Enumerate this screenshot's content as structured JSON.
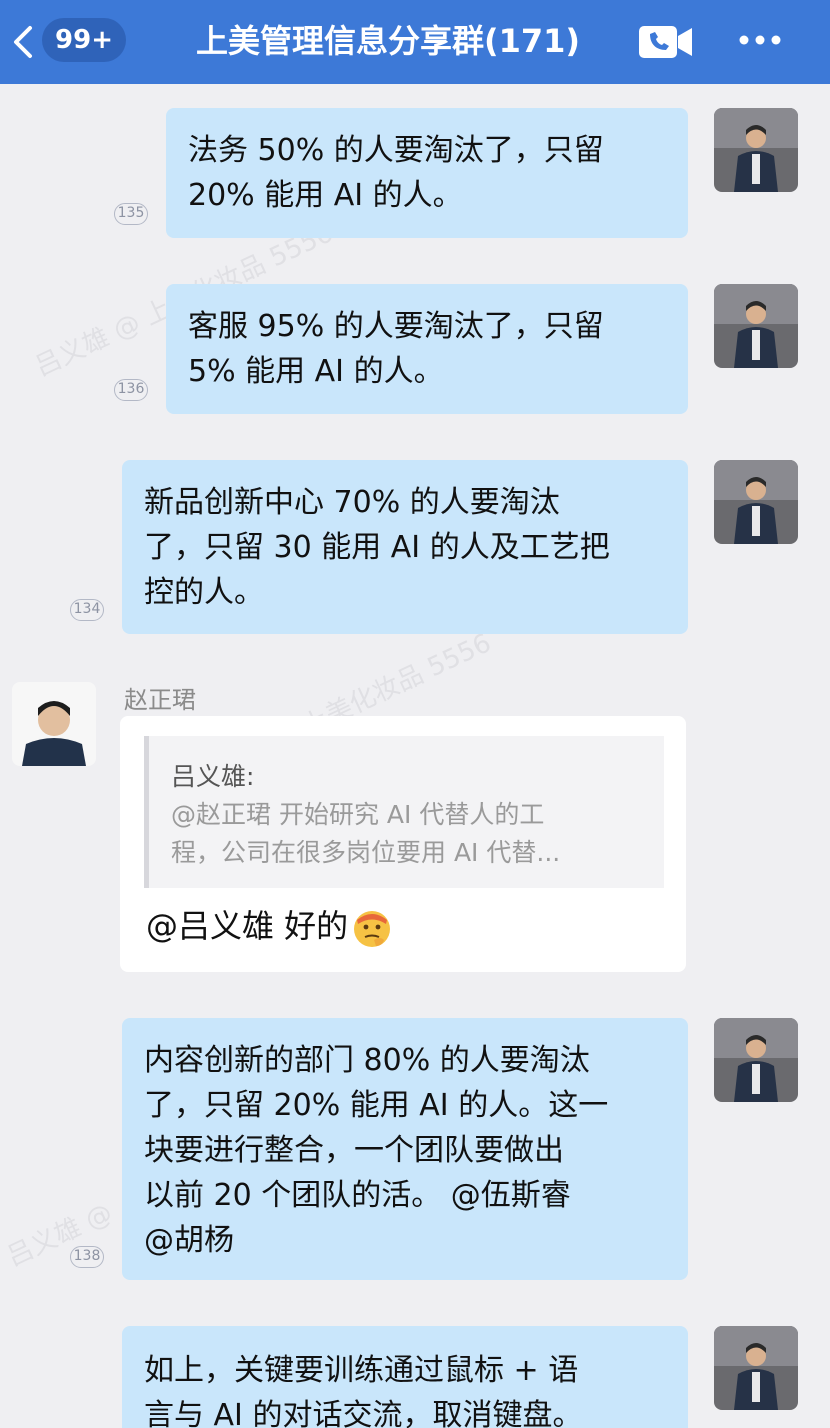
{
  "header": {
    "unread_count": "99+",
    "title": "上美管理信息分享群(171)"
  },
  "watermark": "吕义雄 @ 上美化妆品 5556",
  "messages": [
    {
      "lines": [
        "法务 50% 的人要淘汰了，只留",
        "20% 能用 AI 的人。"
      ],
      "read_count": "135"
    },
    {
      "lines": [
        "客服 95% 的人要淘汰了，只留",
        "5% 能用 AI 的人。"
      ],
      "read_count": "136"
    },
    {
      "lines": [
        "新品创新中心 70% 的人要淘汰",
        "了，只留 30 能用 AI 的人及工艺把",
        "控的人。"
      ],
      "read_count": "134"
    },
    {
      "lines": [
        "内容创新的部门 80% 的人要淘汰",
        "了，只留 20% 能用 AI 的人。这一",
        "块要进行整合，一个团队要做出",
        "以前 20 个团队的活。 @伍斯睿",
        "@胡杨"
      ],
      "read_count": "138"
    },
    {
      "lines": [
        "如上，关键要训练通过鼠标 + 语",
        "言与 AI 的对话交流，取消键盘。"
      ],
      "read_count": ""
    }
  ],
  "reply": {
    "sender": "赵正珺",
    "quote_author": "吕义雄:",
    "quote_lines": [
      "@赵正珺 开始研究 AI 代替人的工",
      "程，公司在很多岗位要用 AI 代替..."
    ],
    "text": "@吕义雄 好的"
  }
}
